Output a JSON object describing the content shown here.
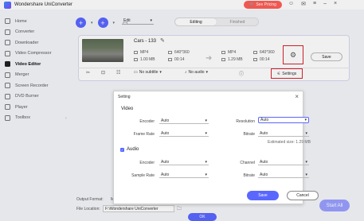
{
  "app": {
    "title": "Wondershare UniConverter",
    "pricing_label": "See Pricing"
  },
  "titlebar_icons": [
    "person-icon",
    "mail-icon",
    "menu-icon",
    "minimize-icon",
    "close-icon"
  ],
  "sidebar": {
    "items": [
      {
        "label": "Home",
        "icon": "home-icon"
      },
      {
        "label": "Converter",
        "icon": "converter-icon"
      },
      {
        "label": "Downloader",
        "icon": "download-icon"
      },
      {
        "label": "Video Compressor",
        "icon": "compress-icon"
      },
      {
        "label": "Video Editor",
        "icon": "scissors-icon",
        "active": true
      },
      {
        "label": "Merger",
        "icon": "merge-icon"
      },
      {
        "label": "Screen Recorder",
        "icon": "record-icon"
      },
      {
        "label": "DVD Burner",
        "icon": "disc-icon"
      },
      {
        "label": "Player",
        "icon": "play-icon"
      },
      {
        "label": "Toolbox",
        "icon": "grid-icon"
      }
    ]
  },
  "toolbar": {
    "format_select": "Edit",
    "tabs": [
      {
        "label": "Editing",
        "active": true
      },
      {
        "label": "Finished",
        "active": false
      }
    ]
  },
  "file": {
    "name": "Cars - 133",
    "source": {
      "format": "MP4",
      "resolution": "640*360",
      "size": "1.00 MB",
      "duration": "00:14"
    },
    "target": {
      "format": "MP4",
      "resolution": "640*360",
      "size": "1.29 MB",
      "duration": "00:14"
    },
    "save_label": "Save",
    "subtitle_select": "No subtitle",
    "audio_select": "No audio",
    "settings_label": "Settings"
  },
  "footer": {
    "output_format_label": "Output Format:",
    "output_format_value": "M",
    "file_location_label": "File Location:",
    "file_location_value": "F:\\Wondershare UniConverter",
    "start_all_label": "Start All",
    "ok_label": "OK"
  },
  "dialog": {
    "title": "Setting",
    "video_label": "Video",
    "encoder_label": "Encoder",
    "encoder_value": "Auto",
    "frame_rate_label": "Frame Rate",
    "frame_rate_value": "Auto",
    "resolution_label": "Resolution",
    "resolution_value": "Auto",
    "bitrate_label": "Bitrate",
    "bitrate_value": "Auto",
    "estimated_size": "Estimated size: 1.29 MB",
    "audio_label": "Audio",
    "audio_encoder_label": "Encoder",
    "audio_encoder_value": "Auto",
    "channel_label": "Channel",
    "channel_value": "Auto",
    "sample_rate_label": "Sample Rate",
    "sample_rate_value": "Auto",
    "audio_bitrate_label": "Bitrate",
    "audio_bitrate_value": "Auto",
    "save_label": "Save",
    "cancel_label": "Cancel"
  },
  "colors": {
    "accent": "#5a67ff",
    "highlight": "#d8242b",
    "pricing": "#ff5e57"
  }
}
